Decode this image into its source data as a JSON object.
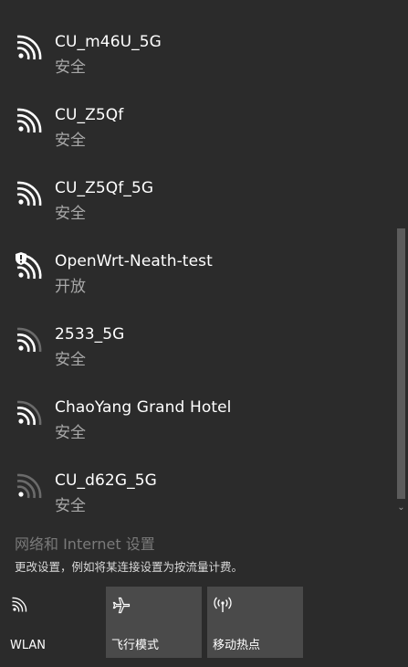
{
  "networks": [
    {
      "ssid": "CU_m46U_5G",
      "status": "安全",
      "strength": "full",
      "shield": false
    },
    {
      "ssid": "CU_Z5Qf",
      "status": "安全",
      "strength": "full",
      "shield": false
    },
    {
      "ssid": "CU_Z5Qf_5G",
      "status": "安全",
      "strength": "full",
      "shield": false
    },
    {
      "ssid": "OpenWrt-Neath-test",
      "status": "开放",
      "strength": "full",
      "shield": true
    },
    {
      "ssid": "2533_5G",
      "status": "安全",
      "strength": "medium",
      "shield": false
    },
    {
      "ssid": "ChaoYang Grand Hotel",
      "status": "安全",
      "strength": "medium",
      "shield": false
    },
    {
      "ssid": "CU_d62G_5G",
      "status": "安全",
      "strength": "low",
      "shield": false
    }
  ],
  "settings": {
    "title": "网络和 Internet 设置",
    "description": "更改设置，例如将某连接设置为按流量计费。"
  },
  "quick_actions": {
    "wlan_label": "WLAN",
    "flight_label": "飞行模式",
    "hotspot_label": "移动热点"
  },
  "colors": {
    "background": "#2b2b2b",
    "tile_background": "#4a4a4a",
    "secondary_text": "#a8a8a8"
  }
}
